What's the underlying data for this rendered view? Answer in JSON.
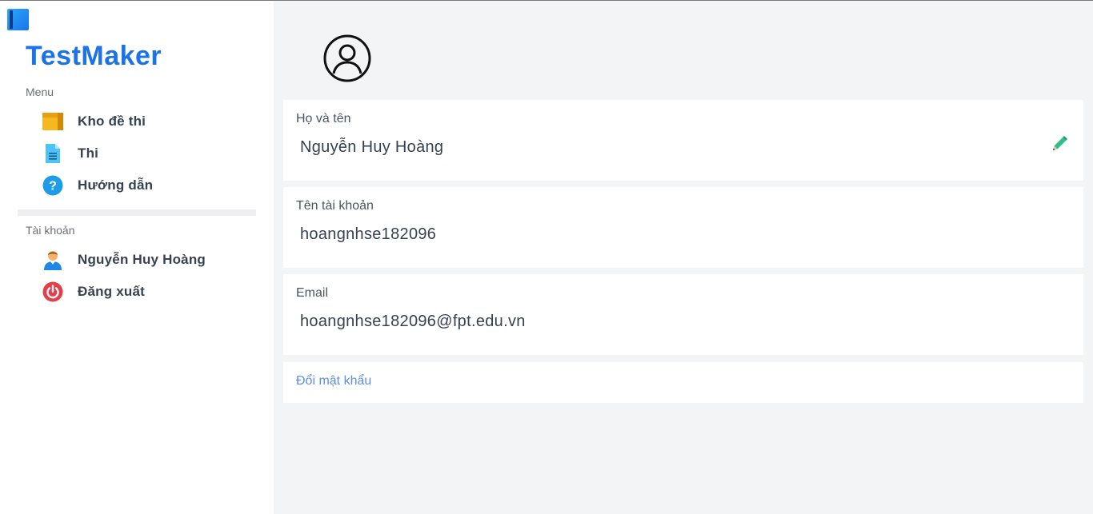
{
  "app": {
    "brand": "TestMaker"
  },
  "sidebar": {
    "menu_label": "Menu",
    "menu_items": [
      {
        "label": "Kho đề thi",
        "icon": "folder-icon"
      },
      {
        "label": "Thi",
        "icon": "document-icon"
      },
      {
        "label": "Hướng dẫn",
        "icon": "help-icon"
      }
    ],
    "account_label": "Tài khoản",
    "account_items": [
      {
        "label": "Nguyễn Huy Hoàng",
        "icon": "user-icon"
      },
      {
        "label": "Đăng xuất",
        "icon": "power-icon"
      }
    ]
  },
  "profile": {
    "avatar_icon": "user-circle-icon",
    "full_name": {
      "label": "Họ và tên",
      "value": "Nguyễn Huy Hoàng"
    },
    "username": {
      "label": "Tên tài khoản",
      "value": "hoangnhse182096"
    },
    "email": {
      "label": "Email",
      "value": "hoangnhse182096@fpt.edu.vn"
    },
    "change_password": "Đổi mật khẩu"
  },
  "colors": {
    "brand": "#1a73e8",
    "link": "#5c8fe6",
    "edit": "#2fbf8a",
    "logout": "#e53e4a"
  }
}
